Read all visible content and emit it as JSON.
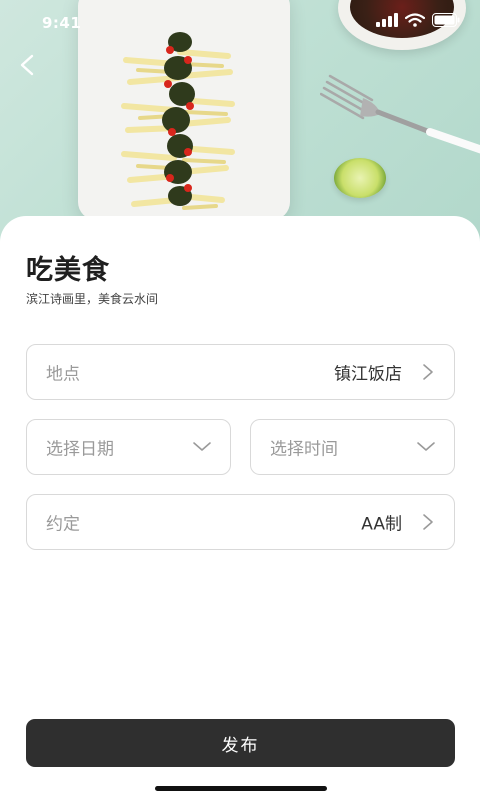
{
  "status_bar": {
    "time": "9:41"
  },
  "hero": {
    "icons": [
      "food-photo",
      "back-icon"
    ]
  },
  "header": {
    "title": "吃美食",
    "subtitle": "滨江诗画里，美食云水间"
  },
  "form": {
    "location": {
      "label": "地点",
      "value": "镇江饭店"
    },
    "date": {
      "placeholder": "选择日期"
    },
    "time": {
      "placeholder": "选择时间"
    },
    "agreement": {
      "label": "约定",
      "value": "AA制"
    }
  },
  "actions": {
    "publish_label": "发布"
  },
  "colors": {
    "button_bg": "#2f2f2f",
    "field_border": "#d9d9d9",
    "hero_bg": "#bfe0d4"
  }
}
